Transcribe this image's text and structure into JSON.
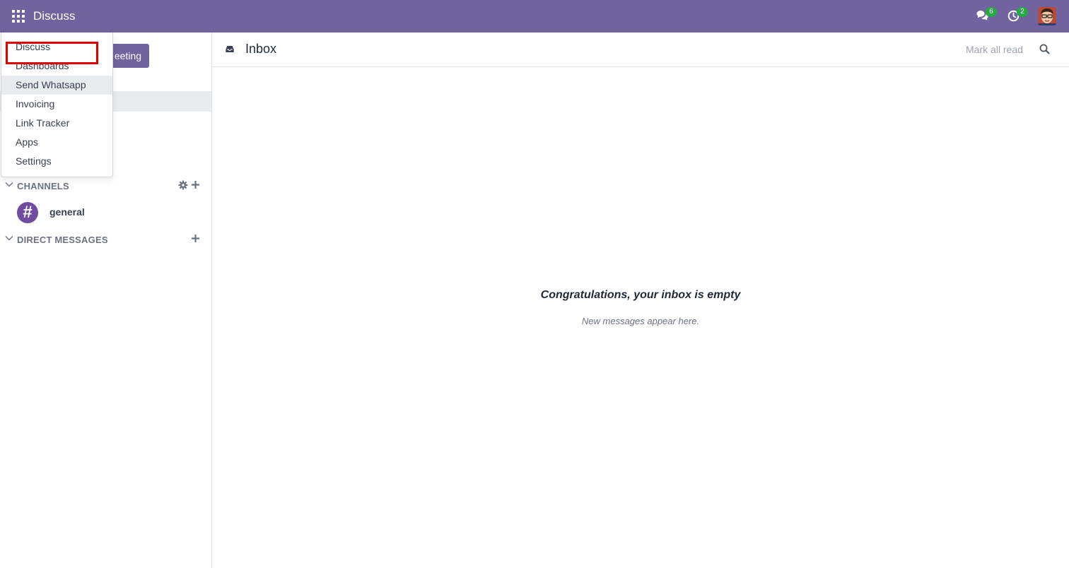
{
  "navbar": {
    "brand": "Discuss",
    "messages_count": "6",
    "activities_count": "2",
    "bg_color": "#71639e",
    "badge_color": "#28a745"
  },
  "sidebar": {
    "meeting_button_partial": "eeting",
    "categories": [
      {
        "label": "CHANNELS"
      },
      {
        "label": "DIRECT MESSAGES"
      }
    ],
    "channels": [
      {
        "avatar": "#",
        "name": "general"
      }
    ]
  },
  "main": {
    "title": "Inbox",
    "mark_all_read": "Mark all read",
    "empty_title": "Congratulations, your inbox is empty",
    "empty_subtitle": "New messages appear here."
  },
  "app_menu": {
    "items": [
      {
        "label": "Discuss"
      },
      {
        "label": "Dashboards"
      },
      {
        "label": "Send Whatsapp"
      },
      {
        "label": "Invoicing"
      },
      {
        "label": "Link Tracker"
      },
      {
        "label": "Apps"
      },
      {
        "label": "Settings"
      }
    ],
    "highlighted_item": "Send Whatsapp",
    "highlight_color": "#e00000"
  }
}
